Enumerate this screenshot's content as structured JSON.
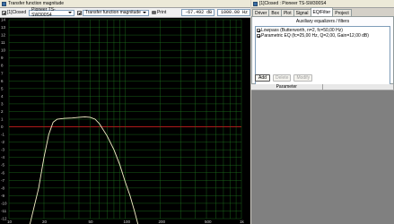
{
  "left_window": {
    "title": "Transfer function magnitude"
  },
  "toolbar": {
    "closed_label": "[1]Closed",
    "driver_label": "Pioneer TS-SW300S4",
    "transfer_select": "Transfer function magnitude",
    "print_label": "Print",
    "readout_db": "-67.492 dB",
    "readout_hz": "1000.00 Hz"
  },
  "graph": {
    "y_ticks": [
      "14",
      "13",
      "12",
      "11",
      "10",
      "9",
      "8",
      "7",
      "6",
      "5",
      "4",
      "3",
      "2",
      "1",
      "0",
      "-1",
      "-2",
      "-3",
      "-4",
      "-5",
      "-6",
      "-7",
      "-8",
      "-9",
      "-10",
      "-11",
      "-12"
    ],
    "x_ticks": [
      "10",
      "20",
      "50",
      "100",
      "200",
      "500",
      "1k"
    ],
    "curve_color": "#f5f0c8",
    "grid_color": "#1f7a1f",
    "zero_line_color": "#c81e1e"
  },
  "right_window": {
    "title": "[1]Closed : Pioneer TS-SW300S4"
  },
  "tabs": [
    {
      "label": "Driver"
    },
    {
      "label": "Box"
    },
    {
      "label": "Plot"
    },
    {
      "label": "Signal"
    },
    {
      "label": "EQ/Filter"
    },
    {
      "label": "Project"
    }
  ],
  "active_tab": "EQ/Filter",
  "eq_panel": {
    "header": "Auxiliary equalizers / filters",
    "filters": [
      {
        "label": "Lowpass (Butterworth, n=2, fc=50,00 Hz)",
        "checked": true
      },
      {
        "label": "Parametric EQ (fc=25,00 Hz, Q=2,00, Gain=12,00 dB)",
        "checked": true
      }
    ],
    "add_label": "Add",
    "delete_label": "Delete",
    "modify_label": "Modify"
  },
  "params": {
    "col1": "Parameter",
    "col2": ""
  }
}
